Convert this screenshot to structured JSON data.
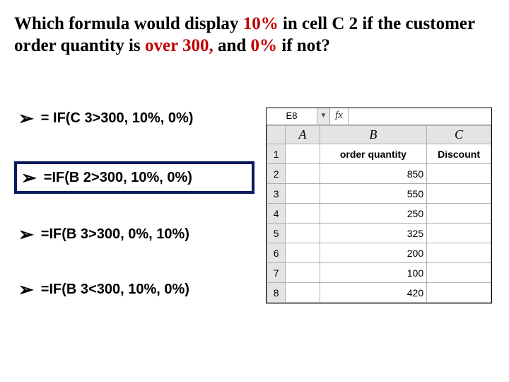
{
  "question": {
    "p1": "Which formula would display ",
    "p2": "10%",
    "p3": " in cell C 2 if the customer order quantity is ",
    "p4": "over 300,",
    "p5": " and ",
    "p6": "0%",
    "p7": " if not?"
  },
  "options": [
    {
      "text": "= IF(C 3>300, 10%, 0%)",
      "boxed": false
    },
    {
      "text": "=IF(B 2>300, 10%, 0%)",
      "boxed": true
    },
    {
      "text": "=IF(B 3>300, 0%, 10%)",
      "boxed": false
    },
    {
      "text": "=IF(B 3<300, 10%, 0%)",
      "boxed": false
    }
  ],
  "sheet": {
    "namebox": "E8",
    "fx": "fx",
    "cols": [
      "A",
      "B",
      "C"
    ],
    "header_b": "order quantity",
    "header_c": "Discount",
    "rows": [
      {
        "n": "1",
        "a": "",
        "b_header": true,
        "c_header": true
      },
      {
        "n": "2",
        "a": "",
        "b": "850",
        "c": ""
      },
      {
        "n": "3",
        "a": "",
        "b": "550",
        "c": ""
      },
      {
        "n": "4",
        "a": "",
        "b": "250",
        "c": ""
      },
      {
        "n": "5",
        "a": "",
        "b": "325",
        "c": ""
      },
      {
        "n": "6",
        "a": "",
        "b": "200",
        "c": ""
      },
      {
        "n": "7",
        "a": "",
        "b": "100",
        "c": ""
      },
      {
        "n": "8",
        "a": "",
        "b": "420",
        "c": ""
      }
    ]
  }
}
